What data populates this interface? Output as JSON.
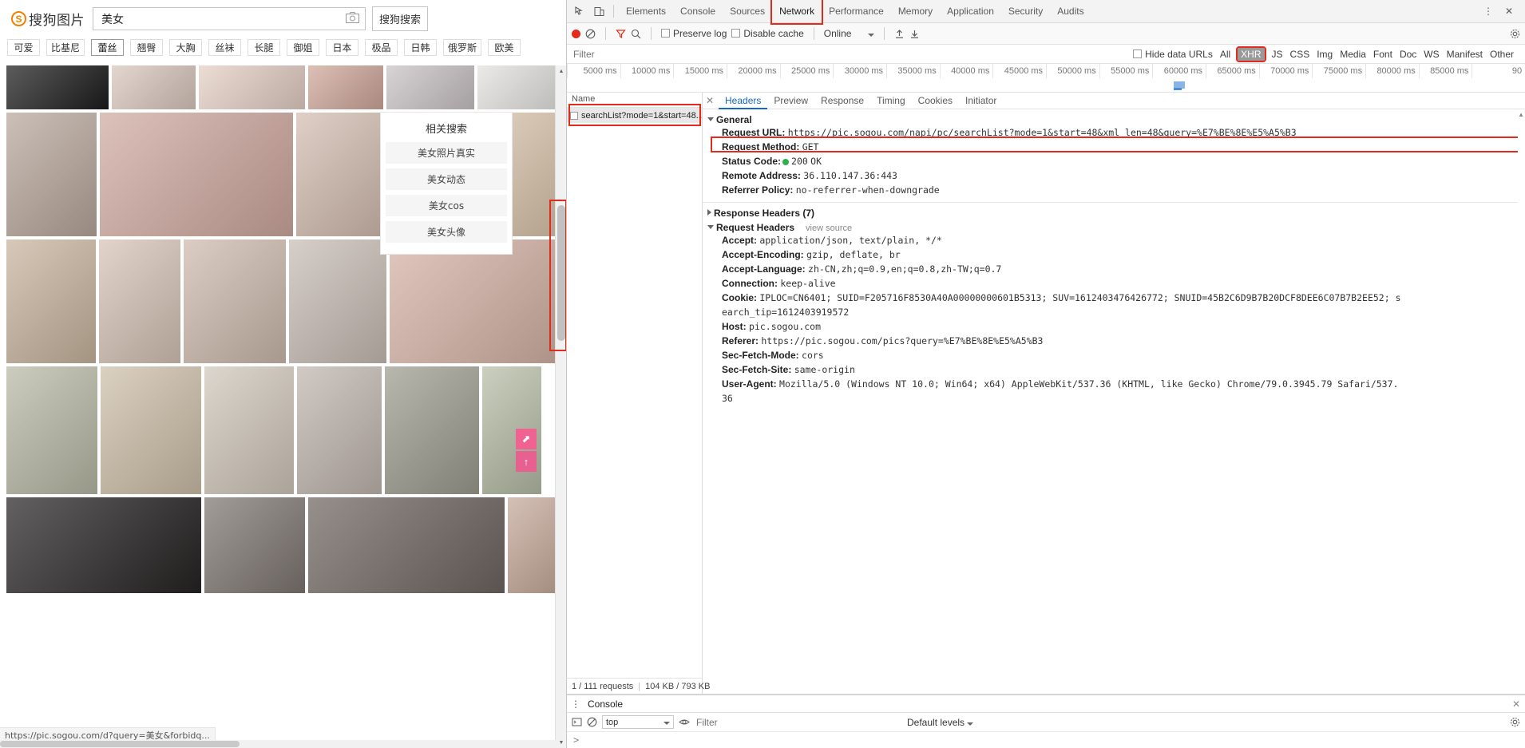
{
  "sogou": {
    "logo_mark": "S",
    "logo_text": "搜狗图片",
    "search_value": "美女",
    "search_placeholder": "",
    "camera_icon": "camera-icon",
    "search_button": "搜狗搜索",
    "tags": [
      {
        "label": "可爱",
        "active": false
      },
      {
        "label": "比基尼",
        "active": false
      },
      {
        "label": "蕾丝",
        "active": true
      },
      {
        "label": "翘臀",
        "active": false
      },
      {
        "label": "大胸",
        "active": false
      },
      {
        "label": "丝袜",
        "active": false
      },
      {
        "label": "长腿",
        "active": false
      },
      {
        "label": "御姐",
        "active": false
      },
      {
        "label": "日本",
        "active": false
      },
      {
        "label": "极品",
        "active": false
      },
      {
        "label": "日韩",
        "active": false
      },
      {
        "label": "俄罗斯",
        "active": false
      },
      {
        "label": "欧美",
        "active": false
      }
    ],
    "related": {
      "title": "相关搜索",
      "items": [
        "美女照片真实",
        "美女动态",
        "美女cos",
        "美女头像"
      ]
    },
    "float_buttons": [
      "share-icon",
      "arrow-up-icon"
    ],
    "status_url": "https://pic.sogou.com/d?query=美女&forbidq..."
  },
  "devtools": {
    "toolbar": {
      "inspect_icon": "inspect-element-icon",
      "device_icon": "device-toolbar-icon",
      "tabs": [
        {
          "label": "Elements",
          "selected": false,
          "highlighted": false
        },
        {
          "label": "Console",
          "selected": false,
          "highlighted": false
        },
        {
          "label": "Sources",
          "selected": false,
          "highlighted": false
        },
        {
          "label": "Network",
          "selected": true,
          "highlighted": true
        },
        {
          "label": "Performance",
          "selected": false,
          "highlighted": false
        },
        {
          "label": "Memory",
          "selected": false,
          "highlighted": false
        },
        {
          "label": "Application",
          "selected": false,
          "highlighted": false
        },
        {
          "label": "Security",
          "selected": false,
          "highlighted": false
        },
        {
          "label": "Audits",
          "selected": false,
          "highlighted": false
        }
      ],
      "more_icon": "more-vertical-icon",
      "close_icon": "close-icon"
    },
    "network_toolbar": {
      "record_icon": "record-button",
      "clear_icon": "clear-icon",
      "filter_icon": "funnel-icon",
      "search_icon": "search-icon",
      "preserve_log": "Preserve log",
      "disable_cache": "Disable cache",
      "throttling": "Online",
      "import_icon": "import-har-icon",
      "export_icon": "export-har-icon",
      "settings_icon": "gear-icon"
    },
    "filter_bar": {
      "placeholder": "Filter",
      "value": "",
      "hide_data_urls": "Hide data URLs",
      "types": [
        {
          "label": "All",
          "selected": false,
          "highlighted": false
        },
        {
          "label": "XHR",
          "selected": true,
          "highlighted": true
        },
        {
          "label": "JS",
          "selected": false,
          "highlighted": false
        },
        {
          "label": "CSS",
          "selected": false,
          "highlighted": false
        },
        {
          "label": "Img",
          "selected": false,
          "highlighted": false
        },
        {
          "label": "Media",
          "selected": false,
          "highlighted": false
        },
        {
          "label": "Font",
          "selected": false,
          "highlighted": false
        },
        {
          "label": "Doc",
          "selected": false,
          "highlighted": false
        },
        {
          "label": "WS",
          "selected": false,
          "highlighted": false
        },
        {
          "label": "Manifest",
          "selected": false,
          "highlighted": false
        },
        {
          "label": "Other",
          "selected": false,
          "highlighted": false
        }
      ]
    },
    "timeline_ticks": [
      "5000 ms",
      "10000 ms",
      "15000 ms",
      "20000 ms",
      "25000 ms",
      "30000 ms",
      "35000 ms",
      "40000 ms",
      "45000 ms",
      "50000 ms",
      "55000 ms",
      "60000 ms",
      "65000 ms",
      "70000 ms",
      "75000 ms",
      "80000 ms",
      "85000 ms",
      "90"
    ],
    "request_list": {
      "column_header": "Name",
      "rows": [
        {
          "name": "searchList?mode=1&start=48..."
        }
      ],
      "status": "1 / 111 requests",
      "transferred": "104 KB / 793 KB"
    },
    "detail": {
      "close_icon": "close-icon",
      "tabs": [
        {
          "label": "Headers",
          "selected": true
        },
        {
          "label": "Preview",
          "selected": false
        },
        {
          "label": "Response",
          "selected": false
        },
        {
          "label": "Timing",
          "selected": false
        },
        {
          "label": "Cookies",
          "selected": false
        },
        {
          "label": "Initiator",
          "selected": false
        }
      ],
      "general": {
        "title": "General",
        "request_url_key": "Request URL:",
        "request_url_value": "https://pic.sogou.com/napi/pc/searchList?mode=1&start=48&xml_len=48&query=%E7%BE%8E%E5%A5%B3",
        "request_method_key": "Request Method:",
        "request_method_value": "GET",
        "status_code_key": "Status Code:",
        "status_code_value": "200",
        "status_code_suffix": "OK",
        "remote_address_key": "Remote Address:",
        "remote_address_value": "36.110.147.36:443",
        "referrer_policy_key": "Referrer Policy:",
        "referrer_policy_value": "no-referrer-when-downgrade"
      },
      "response_headers_title": "Response Headers (7)",
      "request_headers_title": "Request Headers",
      "view_source": "view source",
      "request_headers": [
        {
          "key": "Accept:",
          "value": "application/json, text/plain, */*"
        },
        {
          "key": "Accept-Encoding:",
          "value": "gzip, deflate, br"
        },
        {
          "key": "Accept-Language:",
          "value": "zh-CN,zh;q=0.9,en;q=0.8,zh-TW;q=0.7"
        },
        {
          "key": "Connection:",
          "value": "keep-alive"
        },
        {
          "key": "Cookie:",
          "value": "IPLOC=CN6401; SUID=F205716F8530A40A00000000601B5313; SUV=1612403476426772; SNUID=45B2C6D9B7B20DCF8DEE6C07B7B2EE52; s"
        },
        {
          "key": "",
          "value": "earch_tip=1612403919572"
        },
        {
          "key": "Host:",
          "value": "pic.sogou.com"
        },
        {
          "key": "Referer:",
          "value": "https://pic.sogou.com/pics?query=%E7%BE%8E%E5%A5%B3"
        },
        {
          "key": "Sec-Fetch-Mode:",
          "value": "cors"
        },
        {
          "key": "Sec-Fetch-Site:",
          "value": "same-origin"
        },
        {
          "key": "User-Agent:",
          "value": "Mozilla/5.0 (Windows NT 10.0; Win64; x64) AppleWebKit/537.36 (KHTML, like Gecko) Chrome/79.0.3945.79 Safari/537."
        },
        {
          "key": "",
          "value": "36"
        }
      ]
    },
    "drawer": {
      "more_icon": "more-vertical-icon",
      "tab": "Console",
      "close_icon": "close-icon",
      "execute_icon": "execution-context-icon",
      "clear_icon": "clear-console-icon",
      "context": "top",
      "eye_icon": "live-expression-icon",
      "filter_placeholder": "Filter",
      "levels": "Default levels",
      "prompt": ">",
      "settings_icon": "gear-icon"
    }
  },
  "colors": {
    "accent_red": "#e02b1d",
    "brand_orange": "#f08000",
    "link_blue": "#1667c9",
    "status_green": "#2bb24c"
  }
}
